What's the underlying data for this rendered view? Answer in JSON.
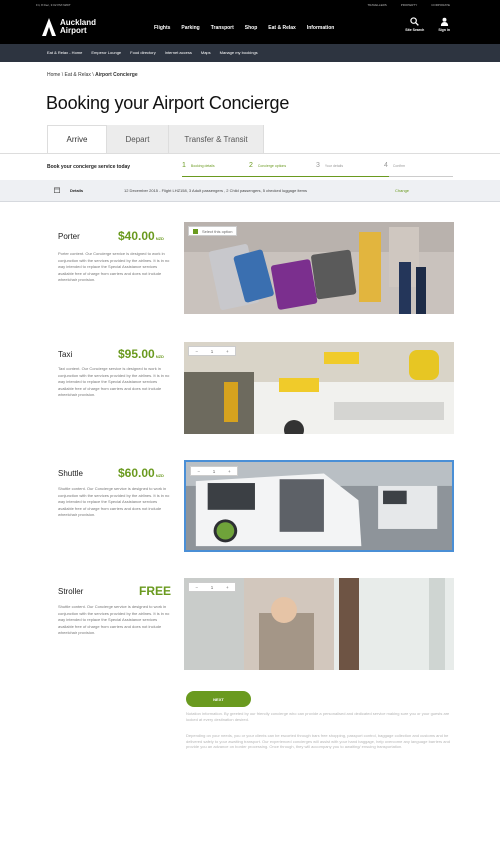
{
  "topbar": {
    "weather": "Fri, 8 Dec, 3:02 PM NZDT",
    "links": [
      "TRAVELLERS",
      "PROPERTY",
      "CORPORATE"
    ]
  },
  "logo": {
    "line1": "Auckland",
    "line2": "Airport"
  },
  "nav": [
    "Flights",
    "Parking",
    "Transport",
    "Shop",
    "Eat & Relax",
    "Information"
  ],
  "tools": {
    "search": "Site Search",
    "signin": "Sign in"
  },
  "subnav": [
    "Eat & Relax - Home",
    "Emperor Lounge",
    "Food directory",
    "Internet access",
    "Maps",
    "Manage my bookings"
  ],
  "breadcrumb": {
    "home": "Home",
    "sep": "\\",
    "section": "Eat & Relax",
    "current": "Airport Concierge"
  },
  "page_title": "Booking your Airport Concierge",
  "tabs": [
    "Arrive",
    "Depart",
    "Transfer & Transit"
  ],
  "steps": {
    "lead": "Book your concierge service today",
    "items": [
      {
        "n": "1",
        "label": "Booking details"
      },
      {
        "n": "2",
        "label": "Concierge options"
      },
      {
        "n": "3",
        "label": "Your details"
      },
      {
        "n": "4",
        "label": "Confirm"
      }
    ]
  },
  "details": {
    "label": "Details",
    "value": "12 December 2015 - Flight LHZ158, 3 Adult passengers , 2 Child passengers, 5 checked luggage items",
    "change": "Change"
  },
  "services": [
    {
      "name": "Porter",
      "price": "$40.00",
      "unit": "NZD",
      "desc": "Porter content. Our Concierge service is designed to work in conjunction with the services provided by the airlines. It is in no way intended to replace the Special Assistance services available free of charge from carriers and does not include wheelchair provision.",
      "control": "Select this option"
    },
    {
      "name": "Taxi",
      "price": "$95.00",
      "unit": "NZD",
      "desc": "Taxi content. Our Concierge service is designed to work in conjunction with the services provided by the airlines. It is in no way intended to replace the Special Assistance services available free of charge from carriers and does not include wheelchair provision.",
      "qty": "1"
    },
    {
      "name": "Shuttle",
      "price": "$60.00",
      "unit": "NZD",
      "desc": "Shuttle content. Our Concierge service is designed to work in conjunction with the services provided by the airlines. It is in no way intended to replace the Special Assistance services available free of charge from carriers and does not include wheelchair provision.",
      "qty": "1"
    },
    {
      "name": "Stroller",
      "price": "FREE",
      "unit": "",
      "desc": "Shuttle content. Our Concierge service is designed to work in conjunction with the services provided by the airlines. It is in no way intended to replace the Special Assistance services available free of charge from carriers and does not include wheelchair provision.",
      "qty": "1"
    }
  ],
  "next_button": "NEXT",
  "footnote1": "Notation information. By greeted by our friendly concierge who can provide a personalised and dedicated service making sure you or your guests are looked at every destination desired.",
  "footnote2": "Depending on your needs, you or your clients can be escorted through bars free shopping, passport control, baggage collection and customs and be delivered safely to your awaiting transport. Our experienced concierges will assist with your hand baggage, help overcome any language barriers and provide you an advance on border processing. Once through, they will accompany you to awaiting/ ensuing transportation."
}
